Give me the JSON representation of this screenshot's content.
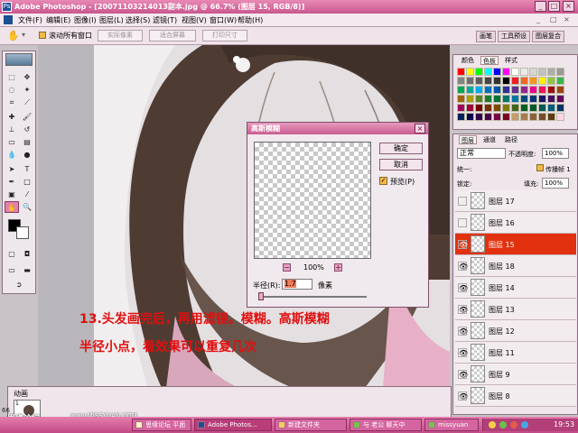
{
  "window": {
    "title": "Adobe Photoshop - [20071103214013副本.jpg @ 66.7% (图层 15, RGB/8)]",
    "icon_label": "Ps",
    "controls": [
      "_",
      "□",
      "×"
    ]
  },
  "menu": [
    "文件(F)",
    "编辑(E)",
    "图像(I)",
    "图层(L)",
    "选择(S)",
    "滤镜(T)",
    "视图(V)",
    "窗口(W)",
    "帮助(H)"
  ],
  "options_bar": {
    "checkbox_label": "滚动所有窗口",
    "buttons": [
      "实际像素",
      "适合屏幕",
      "打印尺寸"
    ],
    "palette_tabs": [
      "画笔",
      "工具预设",
      "图层复合"
    ]
  },
  "dialog": {
    "title": "高斯模糊",
    "close": "×",
    "ok": "确定",
    "cancel": "取消",
    "preview_checkbox": "预览(P)",
    "zoom": "100%",
    "zoom_out": "−",
    "zoom_in": "+",
    "radius_label": "半径(R):",
    "radius_value": "1.7",
    "radius_unit": "像素",
    "radius_slider_fraction": 0.017
  },
  "annotation": {
    "line1": "13.头发画完后，再用滤镜。模糊。高斯模糊",
    "line2": "半径小点，看效果可以重复几次"
  },
  "swatches_panel": {
    "tabs": [
      "颜色",
      "色板",
      "样式"
    ],
    "colors": [
      "#ff0000",
      "#ffff00",
      "#00ff00",
      "#00ffff",
      "#0000ff",
      "#ff00ff",
      "#ffffff",
      "#ebebeb",
      "#d6d6d6",
      "#c2c2c2",
      "#adadad",
      "#999999",
      "#858585",
      "#707070",
      "#5c5c5c",
      "#474747",
      "#333333",
      "#000000",
      "#ed1c24",
      "#f26522",
      "#f7941d",
      "#fff200",
      "#8dc63f",
      "#39b54a",
      "#00a651",
      "#00a99d",
      "#00aeef",
      "#0072bc",
      "#0054a6",
      "#2e3192",
      "#662d91",
      "#92278f",
      "#ec008c",
      "#ed145b",
      "#9e0b0f",
      "#a0410d",
      "#a3620a",
      "#aba000",
      "#598527",
      "#1a7b30",
      "#007236",
      "#00746b",
      "#0076a3",
      "#004a80",
      "#003471",
      "#1b1464",
      "#440e62",
      "#630460",
      "#9e005d",
      "#9e0039",
      "#790000",
      "#7b2e00",
      "#7d4900",
      "#827b00",
      "#406618",
      "#005e20",
      "#005826",
      "#005952",
      "#005b7f",
      "#003663",
      "#002157",
      "#0d004c",
      "#32004b",
      "#4b0049",
      "#7b0046",
      "#7a0026",
      "#c69c6d",
      "#a67c52",
      "#8c6239",
      "#754c24",
      "#603913",
      "#ffd5e5"
    ]
  },
  "layers_panel": {
    "tabs": [
      "图层",
      "通道",
      "路径"
    ],
    "blend_mode": "正常",
    "opacity_label": "不透明度:",
    "opacity_value": "100%",
    "unify_label": "统一:",
    "propagate_label": "传播帧 1",
    "lock_label": "锁定:",
    "fill_label": "填充:",
    "fill_value": "100%",
    "layers": [
      {
        "name": "图层 17",
        "visible": false,
        "selected": false
      },
      {
        "name": "图层 16",
        "visible": false,
        "selected": false
      },
      {
        "name": "图层 15",
        "visible": true,
        "selected": true
      },
      {
        "name": "图层 18",
        "visible": true,
        "selected": false
      },
      {
        "name": "图层 14",
        "visible": true,
        "selected": false
      },
      {
        "name": "图层 13",
        "visible": true,
        "selected": false
      },
      {
        "name": "图层 12",
        "visible": true,
        "selected": false
      },
      {
        "name": "图层 11",
        "visible": true,
        "selected": false
      },
      {
        "name": "图层 9",
        "visible": true,
        "selected": false
      },
      {
        "name": "图层 8",
        "visible": true,
        "selected": false
      }
    ]
  },
  "animation_panel": {
    "tab": "动画",
    "frame_number": "1",
    "frame_time": "0 秒"
  },
  "status_bar": {
    "zoom": "66",
    "watermark": "思缘论坛",
    "watermark_url": "www.MISSYUAN.COM"
  },
  "taskbar": {
    "start": "开始",
    "items": [
      "思缘论坛 平面",
      "Adobe Photos...",
      "新建文件夹",
      "与 老公 聊天中",
      "missyuan"
    ],
    "clock": "19:53"
  }
}
